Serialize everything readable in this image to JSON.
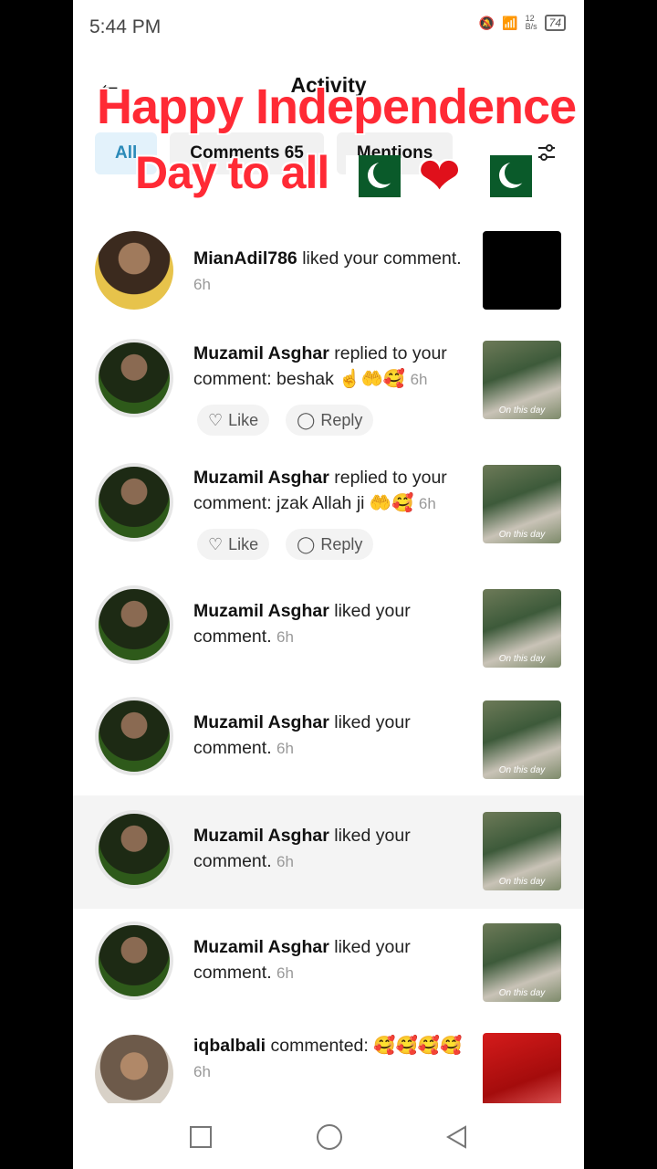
{
  "status": {
    "time": "5:44 PM",
    "net_speed": "12\nB/s",
    "battery": "74"
  },
  "header": {
    "title": "Activity"
  },
  "tabs": [
    {
      "label": "All"
    },
    {
      "label": "Comments 65"
    },
    {
      "label": "Mentions"
    }
  ],
  "overlay": {
    "line1": "Happy Independence",
    "line2": "Day to all"
  },
  "items": [
    {
      "name": "MianAdil786",
      "action": " liked your comment. ",
      "age": "6h"
    },
    {
      "name": "Muzamil Asghar",
      "action": " replied to your comment: beshak ☝️🤲🥰 ",
      "age": "6h",
      "caption": "On this day"
    },
    {
      "name": "Muzamil Asghar",
      "action": " replied to your comment: jzak Allah ji 🤲🥰 ",
      "age": "6h",
      "caption": "On this day"
    },
    {
      "name": "Muzamil Asghar",
      "action": " liked your comment. ",
      "age": "6h",
      "caption": "On this day"
    },
    {
      "name": "Muzamil Asghar",
      "action": " liked your comment. ",
      "age": "6h",
      "caption": "On this day"
    },
    {
      "name": "Muzamil Asghar",
      "action": " liked your comment. ",
      "age": "6h",
      "caption": "On this day"
    },
    {
      "name": "Muzamil Asghar",
      "action": " liked your comment. ",
      "age": "6h",
      "caption": "On this day"
    },
    {
      "name": "iqbalbali",
      "action": " commented: 🥰🥰🥰🥰 ",
      "age": "6h"
    }
  ],
  "actions": {
    "like": "Like",
    "reply": "Reply"
  }
}
